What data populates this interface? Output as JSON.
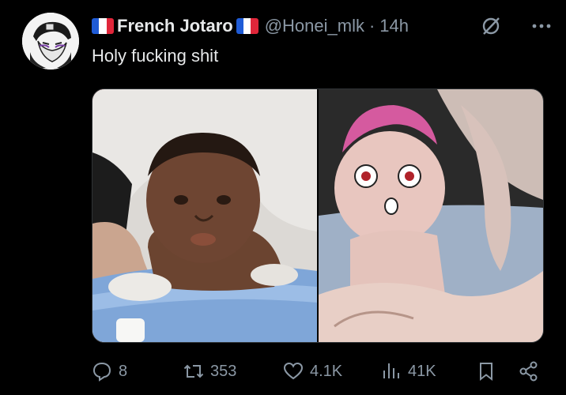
{
  "post": {
    "author_name": "French Jotaro",
    "handle": "@Honei_mlk",
    "separator": "·",
    "time": "14h",
    "text": "Holy fucking shit"
  },
  "icons": {
    "avatar": "avatar",
    "flag": "france-flag-icon",
    "grok": "grok-icon",
    "more": "more-icon",
    "reply": "reply-icon",
    "repost": "repost-icon",
    "like": "like-icon",
    "views": "views-icon",
    "bookmark": "bookmark-icon",
    "share": "share-icon"
  },
  "media": {
    "left_image": "photo of a baby in a blue bathtub",
    "right_image": "anime baby with pink hair in a bathtub"
  },
  "stats": {
    "replies": "8",
    "reposts": "353",
    "likes": "4.1K",
    "views": "41K"
  },
  "colors": {
    "background": "#000000",
    "text": "#e7e9ea",
    "muted": "#8b98a5"
  }
}
